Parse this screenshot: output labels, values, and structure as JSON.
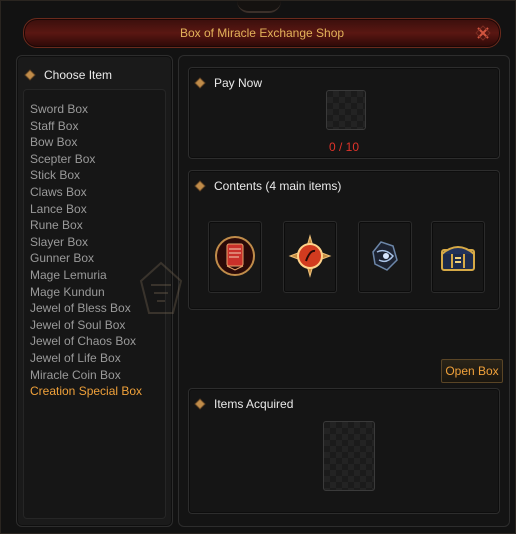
{
  "window": {
    "title": "Box of Miracle Exchange Shop",
    "close_icon": "close-icon"
  },
  "left_panel": {
    "heading": "Choose Item",
    "items": [
      {
        "label": "Sword Box"
      },
      {
        "label": "Staff Box"
      },
      {
        "label": "Bow Box"
      },
      {
        "label": "Scepter Box"
      },
      {
        "label": "Stick Box"
      },
      {
        "label": "Claws Box"
      },
      {
        "label": "Lance Box"
      },
      {
        "label": "Rune Box"
      },
      {
        "label": "Slayer Box"
      },
      {
        "label": "Gunner Box"
      },
      {
        "label": "Mage Lemuria"
      },
      {
        "label": "Mage Kundun"
      },
      {
        "label": "Jewel of Bless Box"
      },
      {
        "label": "Jewel of Soul Box"
      },
      {
        "label": "Jewel of Chaos Box"
      },
      {
        "label": "Jewel of Life Box"
      },
      {
        "label": "Miracle Coin Box"
      },
      {
        "label": "Creation Special Box"
      }
    ],
    "selected_label": "Creation Special Box",
    "selected_color": "#f0a13a"
  },
  "pay_now": {
    "heading": "Pay Now",
    "count": "0 / 10",
    "count_color": "#e0332a"
  },
  "contents": {
    "heading": "Contents (4 main items)",
    "items": [
      {
        "icon": "red-scroll-icon"
      },
      {
        "icon": "sun-emblem-icon"
      },
      {
        "icon": "dark-gem-icon"
      },
      {
        "icon": "treasure-chest-icon"
      }
    ]
  },
  "actions": {
    "open_box_label": "Open Box"
  },
  "items_acquired": {
    "heading": "Items Acquired"
  },
  "colors": {
    "accent": "#f0a13a",
    "title": "#e2b25a",
    "close": "#d2553f"
  }
}
